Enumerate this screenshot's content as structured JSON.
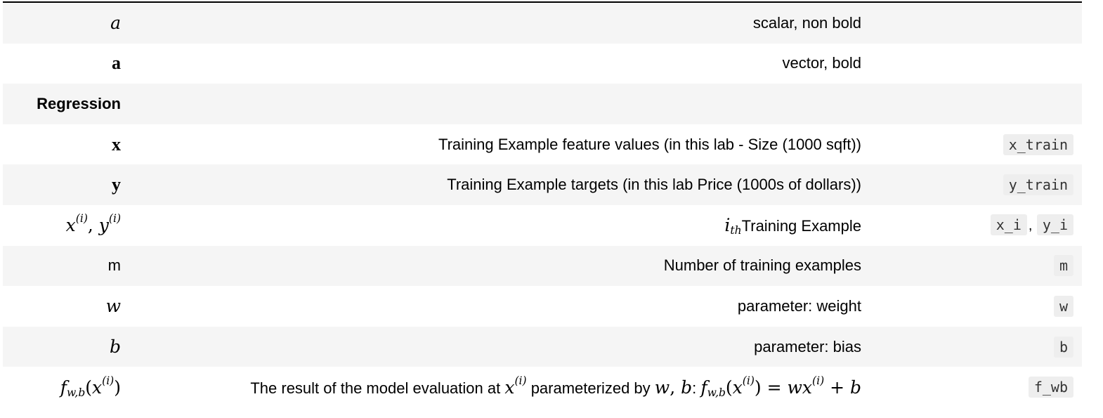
{
  "rows": [
    {
      "notation": "a",
      "description": "scalar, non bold",
      "code": []
    },
    {
      "notation": "a",
      "description": "vector, bold",
      "code": []
    },
    {
      "notation": "Regression",
      "description": "",
      "code": []
    },
    {
      "notation": "x",
      "description": "Training Example feature values (in this lab - Size (1000 sqft))",
      "code": [
        "x_train"
      ]
    },
    {
      "notation": "y",
      "description": "Training Example targets (in this lab Price (1000s of dollars))",
      "code": [
        "y_train"
      ]
    },
    {
      "notation": "x(i), y(i)",
      "description": "Training Example",
      "code": [
        "x_i",
        "y_i"
      ]
    },
    {
      "notation": "m",
      "description": "Number of training examples",
      "code": [
        "m"
      ]
    },
    {
      "notation": "w",
      "description": "parameter: weight",
      "code": [
        "w"
      ]
    },
    {
      "notation": "b",
      "description": "parameter: bias",
      "code": [
        "b"
      ]
    },
    {
      "notation": "fw,b(x(i))",
      "description_parts": [
        "The result of the model evaluation at",
        "parameterized by"
      ],
      "code": [
        "f_wb"
      ]
    }
  ],
  "math": {
    "x": "x",
    "y": "y",
    "i": "i",
    "open": "(",
    "close": ")",
    "comma": ",",
    "ith_base": "i",
    "ith_sub": "th",
    "f": "f",
    "wb": "w,b",
    "w": "w",
    "b": "b",
    "eq": "=",
    "plus": "+",
    "colon": ":"
  }
}
